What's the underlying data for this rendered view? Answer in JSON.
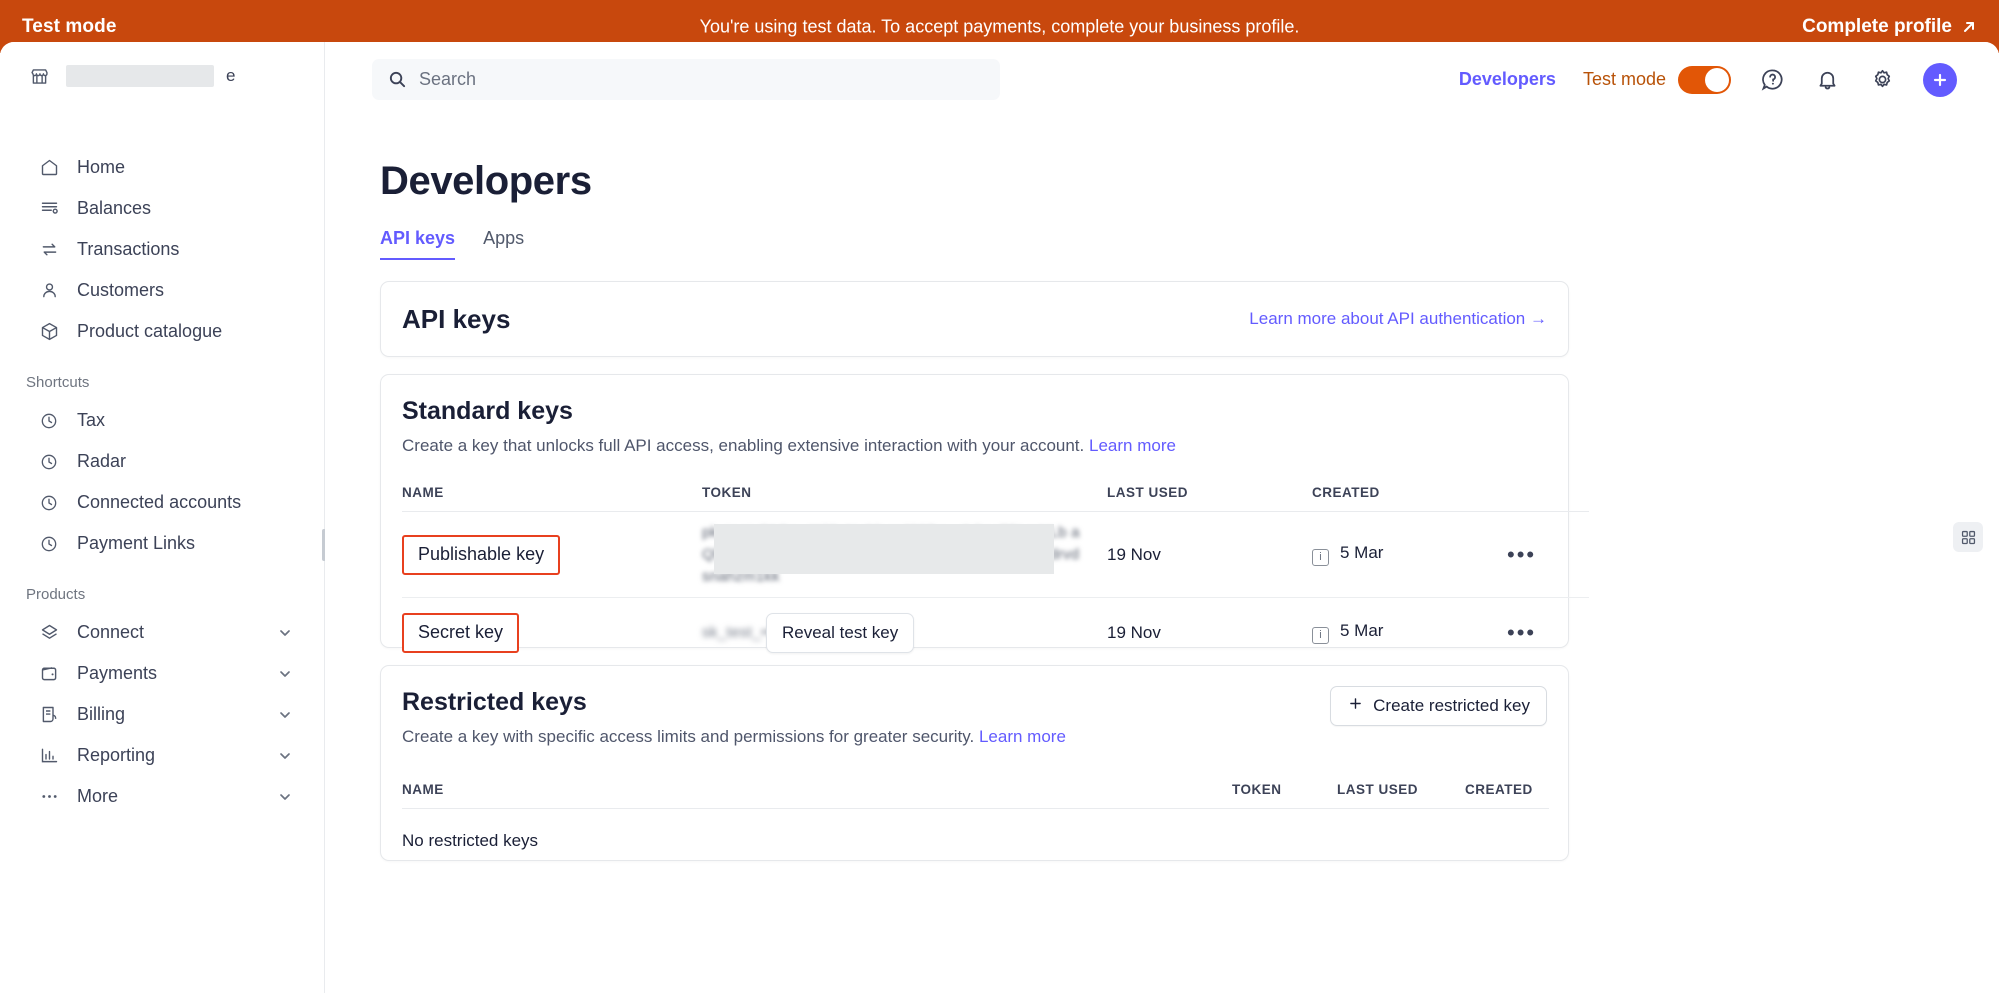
{
  "banner": {
    "left_label": "Test mode",
    "message": "You're using test data. To accept payments, complete your business profile.",
    "cta_label": "Complete profile",
    "cta_icon": "arrow-up-right-icon",
    "background_color": "#c8480d"
  },
  "sidebar": {
    "account": {
      "name_redacted": "",
      "tail": "e",
      "icon": "store-icon"
    },
    "primary_items": [
      {
        "label": "Home",
        "icon": "home-icon"
      },
      {
        "label": "Balances",
        "icon": "balances-icon"
      },
      {
        "label": "Transactions",
        "icon": "transactions-icon"
      },
      {
        "label": "Customers",
        "icon": "customer-icon"
      },
      {
        "label": "Product catalogue",
        "icon": "box-icon"
      }
    ],
    "shortcuts_header": "Shortcuts",
    "shortcut_items": [
      {
        "label": "Tax",
        "icon": "clock-icon"
      },
      {
        "label": "Radar",
        "icon": "clock-icon"
      },
      {
        "label": "Connected accounts",
        "icon": "clock-icon"
      },
      {
        "label": "Payment Links",
        "icon": "clock-icon"
      }
    ],
    "products_header": "Products",
    "product_items": [
      {
        "label": "Connect",
        "icon": "layers-icon",
        "expandable": true
      },
      {
        "label": "Payments",
        "icon": "wallet-icon",
        "expandable": true
      },
      {
        "label": "Billing",
        "icon": "invoice-icon",
        "expandable": true
      },
      {
        "label": "Reporting",
        "icon": "bar-chart-icon",
        "expandable": true
      },
      {
        "label": "More",
        "icon": "ellipsis-icon",
        "expandable": true
      }
    ]
  },
  "topbar": {
    "search_placeholder": "Search",
    "search_icon": "search-icon",
    "developers_label": "Developers",
    "test_mode_label": "Test mode",
    "test_mode_on": true,
    "help_icon": "help-circle-icon",
    "notifications_icon": "bell-icon",
    "settings_icon": "gear-icon",
    "add_icon": "plus-icon",
    "accent_purple": "#635bff",
    "accent_orange": "#e25606"
  },
  "main": {
    "page_title": "Developers",
    "tabs": [
      {
        "label": "API keys",
        "active": true
      },
      {
        "label": "Apps",
        "active": false
      }
    ],
    "api_keys_card": {
      "title": "API keys",
      "learn_more_label": "Learn more about API authentication →"
    },
    "standard_keys": {
      "title": "Standard keys",
      "description": "Create a key that unlocks full API access, enabling extensive interaction with your account.",
      "learn_more_label": "Learn more",
      "columns": [
        "NAME",
        "TOKEN",
        "LAST USED",
        "CREATED"
      ],
      "rows": [
        {
          "name": "Publishable key",
          "name_annotated": true,
          "token": "pk_test_51Oz...WjSxNv28xmJ22Pzuu9dIqcT5LmNLb aQlkjeUHMVhq2OcYH3SmPKrvxwUNr 0gahcuxbvjvdrvdsnahzm1kk",
          "token_masked": true,
          "last_used": "19 Nov",
          "created": "5 Mar",
          "created_has_info_icon": true,
          "actions_icon": "ellipsis-icon"
        },
        {
          "name": "Secret key",
          "name_annotated": true,
          "token": "sk_test_•••••••••••••••••••••",
          "reveal_button_label": "Reveal test key",
          "last_used": "19 Nov",
          "created": "5 Mar",
          "created_has_info_icon": true,
          "actions_icon": "ellipsis-icon"
        }
      ]
    },
    "restricted_keys": {
      "title": "Restricted keys",
      "description": "Create a key with specific access limits and permissions for greater security.",
      "learn_more_label": "Learn more",
      "create_button_label": "Create restricted key",
      "create_button_icon": "plus-icon",
      "columns": [
        "NAME",
        "TOKEN",
        "LAST USED",
        "CREATED"
      ],
      "empty_message": "No restricted keys"
    },
    "annotation_color": "#e8401f"
  },
  "right_widget": {
    "icon": "grid-apps-icon"
  }
}
